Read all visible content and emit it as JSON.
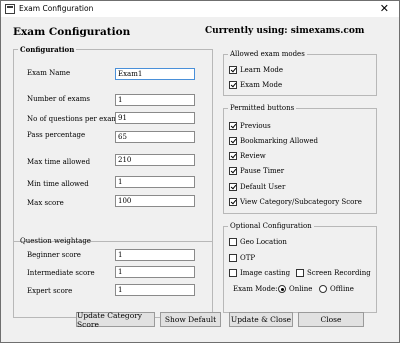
{
  "window": {
    "title": "Exam Configuration",
    "close_glyph": "✕"
  },
  "header": {
    "title": "Exam Configuration",
    "currently_using": "Currently using: simexams.com"
  },
  "configuration": {
    "legend": "Configuration",
    "fields": [
      {
        "label": "Exam Name",
        "value": "Exam1"
      },
      {
        "label": "Number of exams",
        "value": "1"
      },
      {
        "label": "No of questions per exam",
        "value": "91"
      },
      {
        "label": "Pass percentage",
        "value": "65"
      },
      {
        "label": "Max time allowed",
        "value": "210"
      },
      {
        "label": "Min time allowed",
        "value": "1"
      },
      {
        "label": "Max score",
        "value": "100"
      }
    ]
  },
  "weightage": {
    "legend": "Question weightage",
    "fields": [
      {
        "label": "Beginner score",
        "value": "1"
      },
      {
        "label": "Intermediate score",
        "value": "1"
      },
      {
        "label": "Expert score",
        "value": "1"
      }
    ]
  },
  "allowed_modes": {
    "legend": "Allowed exam modes",
    "items": [
      {
        "label": "Learn Mode",
        "checked": true
      },
      {
        "label": "Exam Mode",
        "checked": true
      }
    ]
  },
  "permitted_buttons": {
    "legend": "Permitted buttons",
    "items": [
      {
        "label": "Previous",
        "checked": true
      },
      {
        "label": "Bookmarking Allowed",
        "checked": true
      },
      {
        "label": "Review",
        "checked": true
      },
      {
        "label": "Pause Timer",
        "checked": true
      },
      {
        "label": "Default User",
        "checked": true
      },
      {
        "label": "View Category/Subcategory Score",
        "checked": true
      }
    ]
  },
  "optional": {
    "legend": "Optional Configuration",
    "geo_location": "Geo Location",
    "otp": "OTP",
    "image_casting": "Image casting",
    "screen_recording": "Screen Recording",
    "exam_mode_label": "Exam Mode:",
    "online": "Online",
    "offline": "Offline"
  },
  "buttons": {
    "update_category": "Update Category Score",
    "show_default": "Show Default",
    "update_close": "Update & Close",
    "close": "Close"
  }
}
